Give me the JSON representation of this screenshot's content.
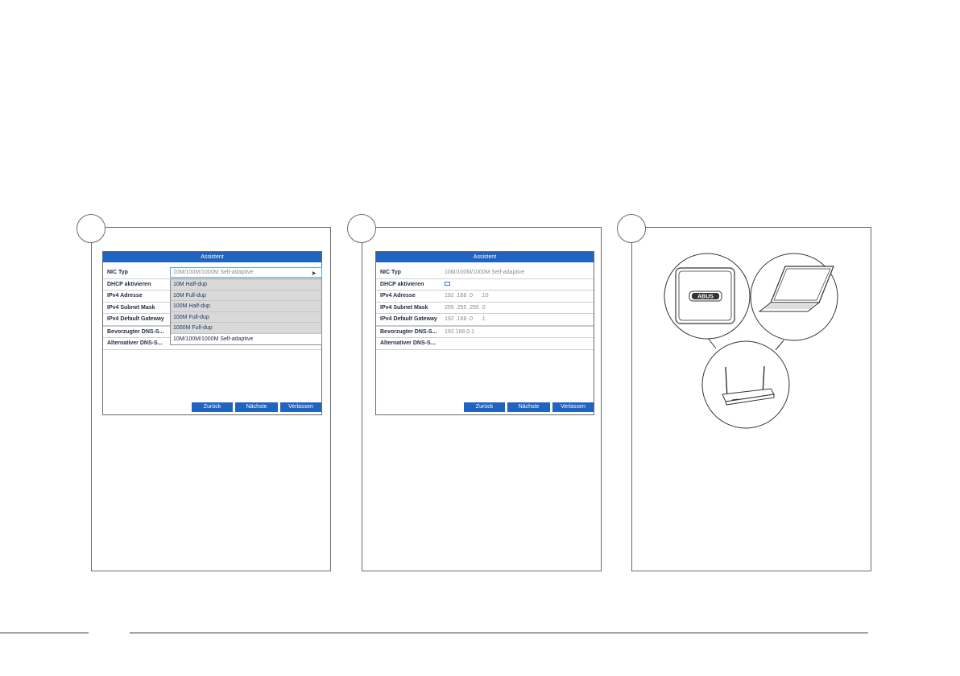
{
  "dialog_title": "Assistent",
  "panel1": {
    "rows": [
      {
        "label": "NIC Typ",
        "value": "10M/100M/1000M Self-adaptive"
      },
      {
        "label": "DHCP aktivieren"
      },
      {
        "label": "IPv4 Adresse"
      },
      {
        "label": "IPv4 Subnet Mask"
      },
      {
        "label": "IPv4 Default Gateway"
      },
      {
        "label": "Bevorzugter DNS-S..."
      },
      {
        "label": "Alternativer DNS-S..."
      }
    ],
    "dropdown": [
      "10M Half-dup",
      "10M Full-dup",
      "100M Half-dup",
      "100M Full-dup",
      "1000M Full-dup",
      "10M/100M/1000M Self-adaptive"
    ]
  },
  "panel2": {
    "rows": [
      {
        "label": "NIC Typ",
        "value": "10M/100M/1000M Self-adaptive"
      },
      {
        "label": "DHCP aktivieren",
        "checkbox": false
      },
      {
        "label": "IPv4 Adresse",
        "value": "192 .168 .0     .10"
      },
      {
        "label": "IPv4 Subnet Mask",
        "value": "255 .255 .255 .0"
      },
      {
        "label": "IPv4 Default Gateway",
        "value": "192 .168 .0     .1"
      },
      {
        "label": "Bevorzugter DNS-S...",
        "value": "192.168.0.1"
      },
      {
        "label": "Alternativer DNS-S...",
        "value": ""
      }
    ]
  },
  "buttons": {
    "back": "Zurück",
    "next": "Nächste",
    "exit": "Verlassen"
  },
  "diagram": {
    "logo_text": "ABUS",
    "devices": [
      "recorder",
      "laptop",
      "router"
    ]
  },
  "colors": {
    "accent": "#1f64c0",
    "dropdown_bg": "#d9d9d9",
    "border": "#6b6b6b"
  }
}
